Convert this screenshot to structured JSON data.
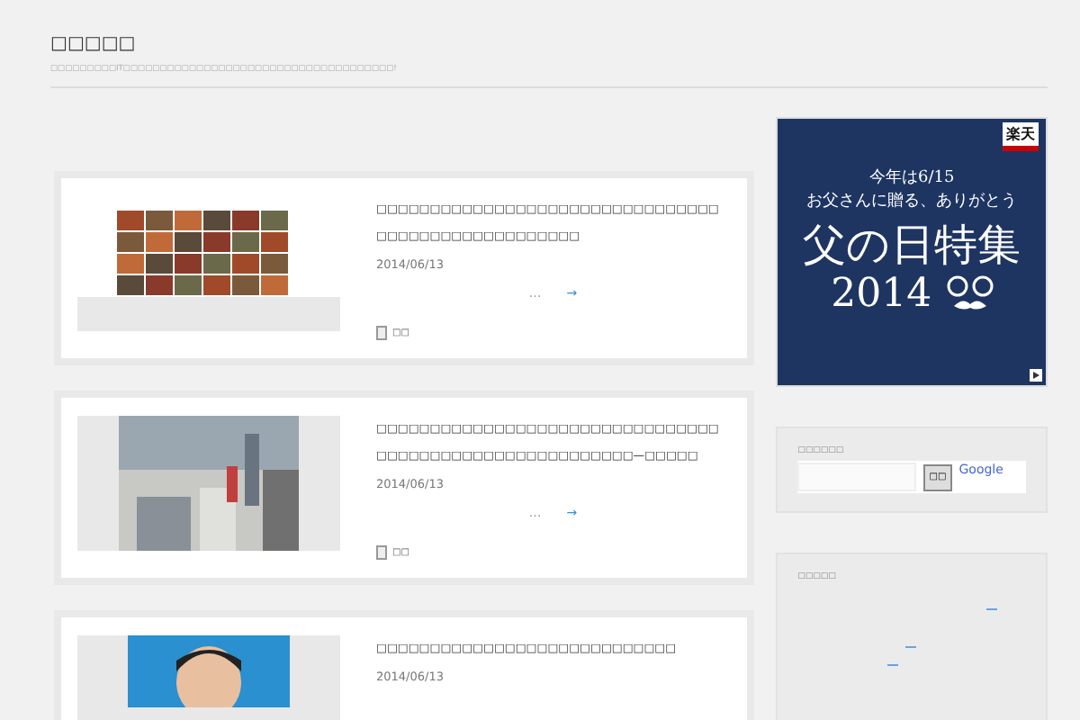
{
  "site": {
    "title": "□□□□□",
    "tagline": "□□□□□□□□□IT□□□□□□□□□□□□□□□□□□□□□□□□□□□□□□□□□□□□□!"
  },
  "posts": [
    {
      "title": "□□□□□□□□□□□□□□□□□□□□□□□□□□□□□□□□□□□□□□□□□□□□□□□□□□□",
      "date": "2014/06/13",
      "excerpt": "…",
      "more": "→",
      "category": "□□"
    },
    {
      "title": "□□□□□□□□□□□□□□□□□□□□□□□□□□□□□□□□□□□□□□□□□□□□□□□□□□□□□□□□—□□□□□",
      "date": "2014/06/13",
      "excerpt": "…",
      "more": "→",
      "category": "□□"
    },
    {
      "title": "□□□□□□□□□□□□□□□□□□□□□□□□□□□□",
      "date": "2014/06/13"
    }
  ],
  "banner": {
    "brand": "楽天",
    "line1": "今年は6/15",
    "line2": "お父さんに贈る、ありがとう",
    "headline": "父の日特集",
    "year": "2014"
  },
  "search_widget": {
    "title": "□□□□□□",
    "button": "□□",
    "brand": "Google"
  },
  "recent_widget": {
    "title": "□□□□□"
  }
}
